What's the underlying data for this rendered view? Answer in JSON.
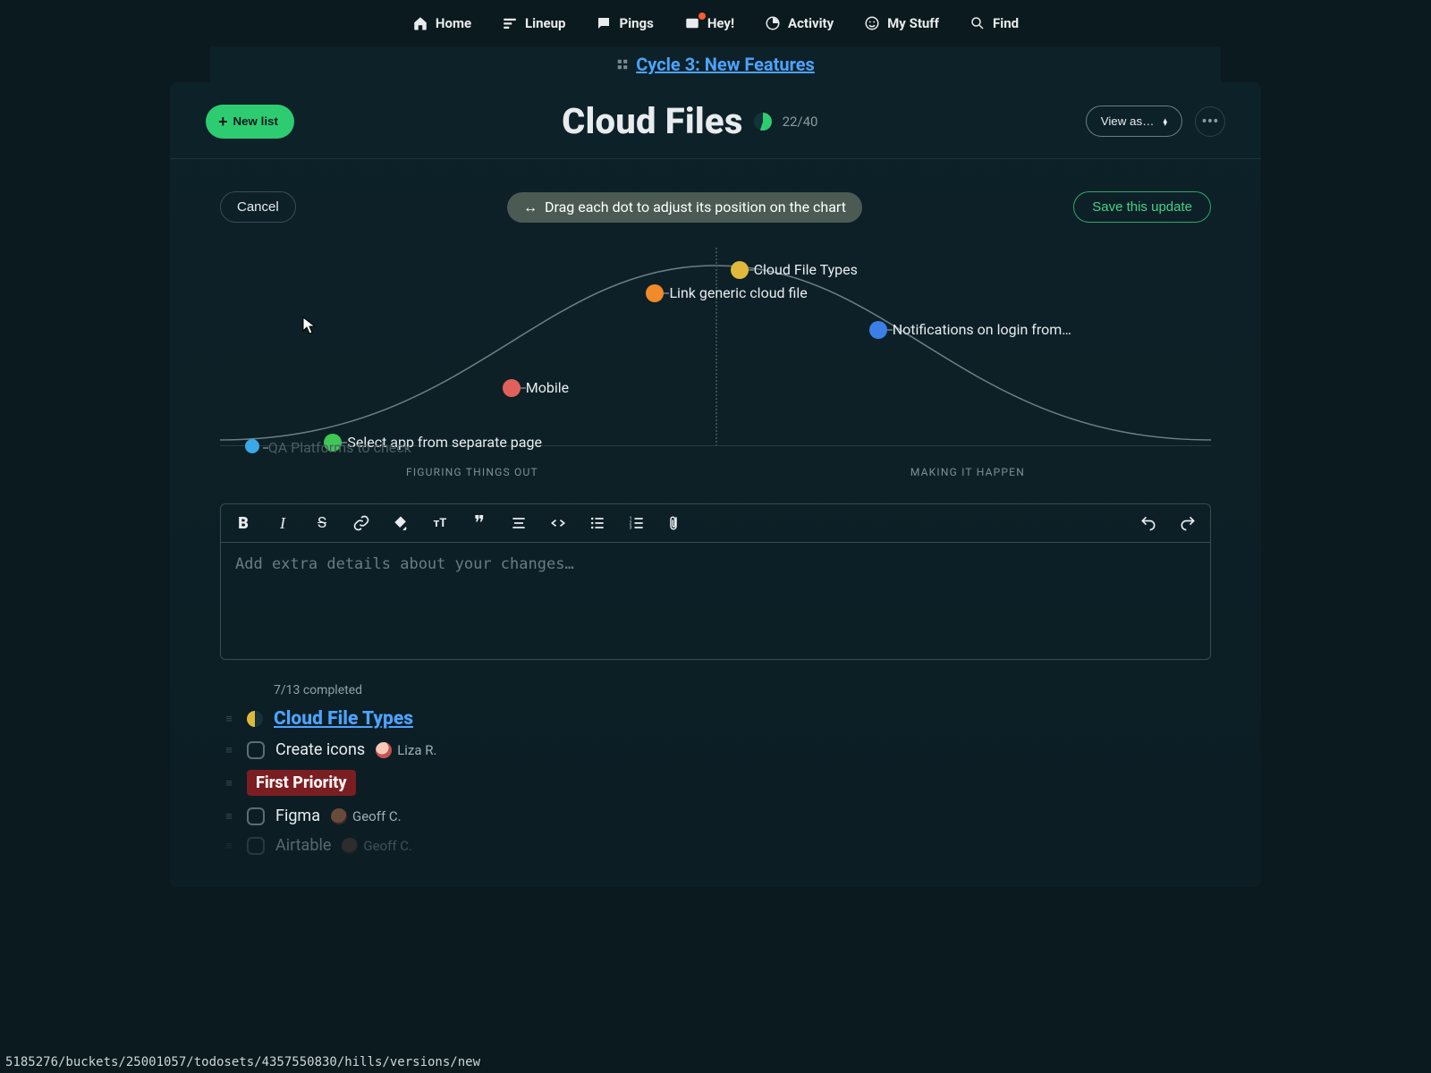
{
  "nav": {
    "home": "Home",
    "lineup": "Lineup",
    "pings": "Pings",
    "hey": "Hey!",
    "activity": "Activity",
    "mystuff": "My Stuff",
    "find": "Find"
  },
  "breadcrumb": {
    "project": "Cycle 3: New Features"
  },
  "header": {
    "new_list": "New list",
    "title": "Cloud Files",
    "counter": "22/40",
    "view_as": "View as…"
  },
  "hill": {
    "cancel": "Cancel",
    "save": "Save this update",
    "hint": "Drag each dot to adjust its position on the chart",
    "left_label": "FIGURING THINGS OUT",
    "right_label": "MAKING IT HAPPEN",
    "dots": {
      "cloud_types": {
        "label": "Cloud File Types"
      },
      "link_generic": {
        "label": "Link generic cloud file"
      },
      "notifications": {
        "label": "Notifications on login from…"
      },
      "mobile": {
        "label": "Mobile"
      },
      "select_app": {
        "label": "Select app from separate page"
      },
      "qa": {
        "label": "QA Platforms to check"
      }
    }
  },
  "editor": {
    "placeholder": "Add extra details about your changes…"
  },
  "list": {
    "completed": "7/13 completed",
    "group_title": "Cloud File Types",
    "tasks": {
      "create_icons": {
        "title": "Create icons",
        "assignee": "Liza R."
      },
      "figma": {
        "title": "Figma",
        "assignee": "Geoff C."
      },
      "airtable": {
        "title": "Airtable",
        "assignee": "Geoff C."
      }
    },
    "tag": "First Priority"
  },
  "status_url": "5185276/buckets/25001057/todosets/4357550830/hills/versions/new"
}
